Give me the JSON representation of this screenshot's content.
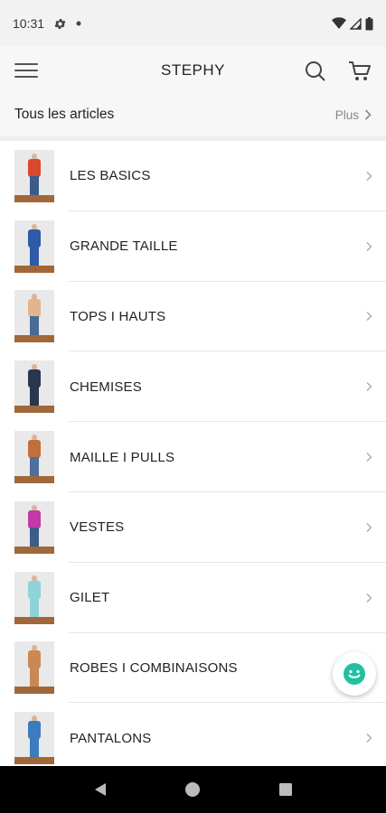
{
  "status_bar": {
    "time": "10:31"
  },
  "app_bar": {
    "title": "STEPHY"
  },
  "section": {
    "title": "Tous les articles",
    "more_label": "Plus"
  },
  "categories": [
    {
      "label": "LES BASICS",
      "top_color": "#d9482b",
      "bottom_color": "#3a5c8c"
    },
    {
      "label": "GRANDE TAILLE",
      "top_color": "#2f5aa8",
      "bottom_color": "#2f5aa8"
    },
    {
      "label": "TOPS I HAUTS",
      "top_color": "#e3b48e",
      "bottom_color": "#4a6b96"
    },
    {
      "label": "CHEMISES",
      "top_color": "#2a3550",
      "bottom_color": "#2a3550"
    },
    {
      "label": "MAILLE I PULLS",
      "top_color": "#c0703a",
      "bottom_color": "#4d6f9a"
    },
    {
      "label": "VESTES",
      "top_color": "#c23aa6",
      "bottom_color": "#3c5d8a"
    },
    {
      "label": "GILET",
      "top_color": "#8fd3d8",
      "bottom_color": "#8fd3d8"
    },
    {
      "label": "ROBES I COMBINAISONS",
      "top_color": "#c88a52",
      "bottom_color": "#c88a52"
    },
    {
      "label": "PANTALONS",
      "top_color": "#3d7bbf",
      "bottom_color": "#3d7bbf"
    }
  ],
  "icons": {
    "menu": "hamburger-icon",
    "search": "search-icon",
    "cart": "cart-icon",
    "chevron": "chevron-right-icon",
    "chat": "chat-smiley-icon",
    "back": "back-triangle-icon",
    "home": "home-circle-icon",
    "recents": "recents-square-icon"
  },
  "colors": {
    "accent": "#1fc1a0",
    "nav_bar": "#000000",
    "floor": "#a0683a"
  }
}
